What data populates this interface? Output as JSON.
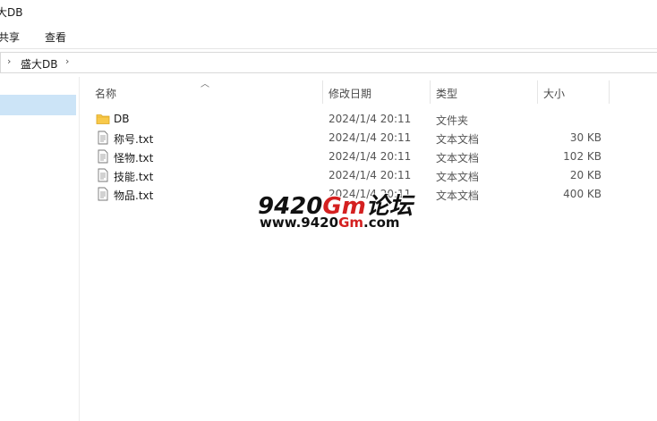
{
  "window": {
    "title": "大DB"
  },
  "ribbon": {
    "tabs": [
      "共享",
      "查看"
    ]
  },
  "address": {
    "crumb": "盛大DB"
  },
  "columns": {
    "name": "名称",
    "date": "修改日期",
    "type": "类型",
    "size": "大小"
  },
  "files": [
    {
      "name": "DB",
      "date": "2024/1/4 20:11",
      "type": "文件夹",
      "size": "",
      "icon": "folder-icon"
    },
    {
      "name": "称号.txt",
      "date": "2024/1/4 20:11",
      "type": "文本文档",
      "size": "30 KB",
      "icon": "text-file-icon"
    },
    {
      "name": "怪物.txt",
      "date": "2024/1/4 20:11",
      "type": "文本文档",
      "size": "102 KB",
      "icon": "text-file-icon"
    },
    {
      "name": "技能.txt",
      "date": "2024/1/4 20:11",
      "type": "文本文档",
      "size": "20 KB",
      "icon": "text-file-icon"
    },
    {
      "name": "物品.txt",
      "date": "2024/1/4 20:11",
      "type": "文本文档",
      "size": "400 KB",
      "icon": "text-file-icon"
    }
  ],
  "watermark": {
    "line1_a": "9420",
    "line1_b": "Gm",
    "line1_c": "论坛",
    "line2_a": "www.9420",
    "line2_b": "Gm",
    "line2_c": ".com"
  },
  "colors": {
    "selection": "#cce4f7",
    "folder": "#f8c94a",
    "accent": "#d42020"
  }
}
